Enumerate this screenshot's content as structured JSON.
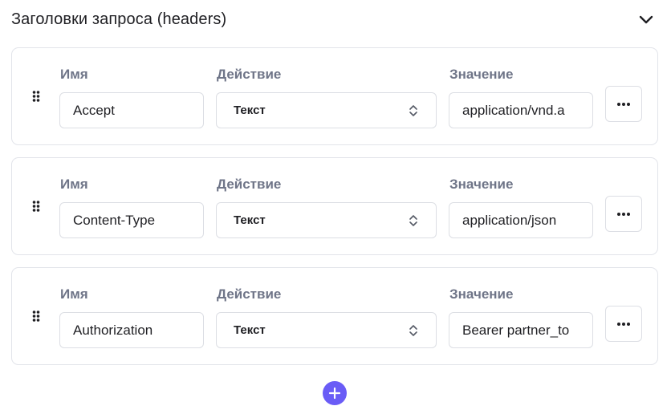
{
  "section": {
    "title": "Заголовки запроса (headers)",
    "collapse_icon": "chevron-down-icon"
  },
  "labels": {
    "name": "Имя",
    "action": "Действие",
    "value": "Значение"
  },
  "headers": [
    {
      "name": "Accept",
      "action": "Текст",
      "value": "application/vnd.a"
    },
    {
      "name": "Content-Type",
      "action": "Текст",
      "value": "application/json"
    },
    {
      "name": "Authorization",
      "action": "Текст",
      "value": "Bearer partner_to"
    }
  ],
  "icons": {
    "drag": "drag-handle-icon",
    "select": "select-arrows-icon",
    "more": "more-horizontal-icon",
    "add": "plus-icon"
  },
  "colors": {
    "accent": "#6a5cf6",
    "label": "#6f7588",
    "border": "#dcdee4",
    "text": "#1f1f23"
  }
}
